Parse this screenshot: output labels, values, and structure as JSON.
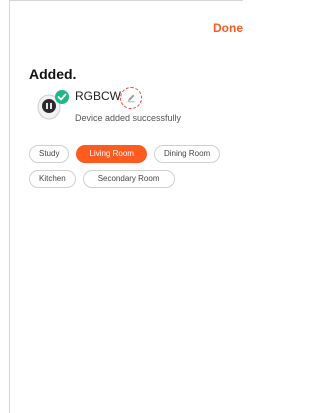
{
  "header": {
    "done_label": "Done"
  },
  "page": {
    "title": "Added."
  },
  "device": {
    "name": "RGBCW",
    "status": "Device added successfully",
    "icon": "smart-plug-icon",
    "success_badge": "check-circle-icon",
    "edit_icon": "pencil-icon"
  },
  "rooms": {
    "selected": "Living Room",
    "items": [
      {
        "label": "Study"
      },
      {
        "label": "Living Room"
      },
      {
        "label": "Dining Room"
      },
      {
        "label": "Kitchen"
      },
      {
        "label": "Secondary Room"
      }
    ]
  },
  "colors": {
    "accent": "#ff5a1f",
    "success": "#1fb88a",
    "edit_ring": "#ff3b30"
  }
}
